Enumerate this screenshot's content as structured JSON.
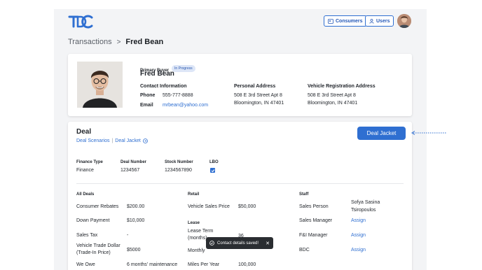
{
  "brand": {
    "logo_text": "TDC",
    "accent": "#2f6fd1"
  },
  "nav": {
    "consumers_label": "Consumers",
    "users_label": "Users"
  },
  "breadcrumb": {
    "root": "Transactions",
    "separator": ">",
    "current": "Fred Bean"
  },
  "buyer": {
    "role": "Primary Buyer",
    "status": "In Progress",
    "name": "Fred Bean",
    "contact_heading": "Contact Information",
    "phone_label": "Phone",
    "phone": "555-777-8888",
    "email_label": "Email",
    "email": "mrbean@yahoo.com",
    "personal_address_heading": "Personal Address",
    "personal_address_line1": "508 E 3rd Street Apt 8",
    "personal_address_line2": "Bloomington, IN 47401",
    "vehicle_address_heading": "Vehicle Registration Address",
    "vehicle_address_line1": "508 E 3rd Street Apt 8",
    "vehicle_address_line2": "Bloomington, IN 47401"
  },
  "deal": {
    "title": "Deal",
    "link_scenarios": "Deal Scenarios",
    "link_separator": "|",
    "link_jacket": "Deal Jacket",
    "jacket_button": "Deal Jacket",
    "finance_type_label": "Finance Type",
    "finance_type": "Finance",
    "deal_number_label": "Deal Number",
    "deal_number": "1234567",
    "stock_number_label": "Stock Number",
    "stock_number": "1234567890",
    "lbo_label": "LBO",
    "all_deals_heading": "All Deals",
    "all_deals": [
      {
        "label": "Consumer Rebates",
        "value": "$200.00"
      },
      {
        "label": "Down Payment",
        "value": "$10,000"
      },
      {
        "label": "Sales Tax",
        "value": "-"
      },
      {
        "label": "Vehicle Trade Dollar (Trade-In Price)",
        "value": "$5000"
      },
      {
        "label": "We Owe",
        "value": "6 months' maintenance"
      }
    ],
    "retail_heading": "Retail",
    "retail_label": "Vehicle Sales Price",
    "retail_value": "$50,000",
    "lease_heading": "Lease",
    "lease_term_label": "Lease Term (months)",
    "lease_term_value": "36",
    "monthly_label": "Monthly",
    "miles_label": "Miles Per Year",
    "miles_value": "100,000",
    "staff_heading": "Staff",
    "staff": [
      {
        "label": "Sales Person",
        "value": "Sofya Sasina Tsiropoulos"
      },
      {
        "label": "Sales Manager",
        "value": "Assign"
      },
      {
        "label": "F&I Manager",
        "value": "Assign"
      },
      {
        "label": "BDC",
        "value": "Assign"
      }
    ]
  },
  "toast": {
    "message": "Contact details saved!",
    "close": "✕"
  }
}
